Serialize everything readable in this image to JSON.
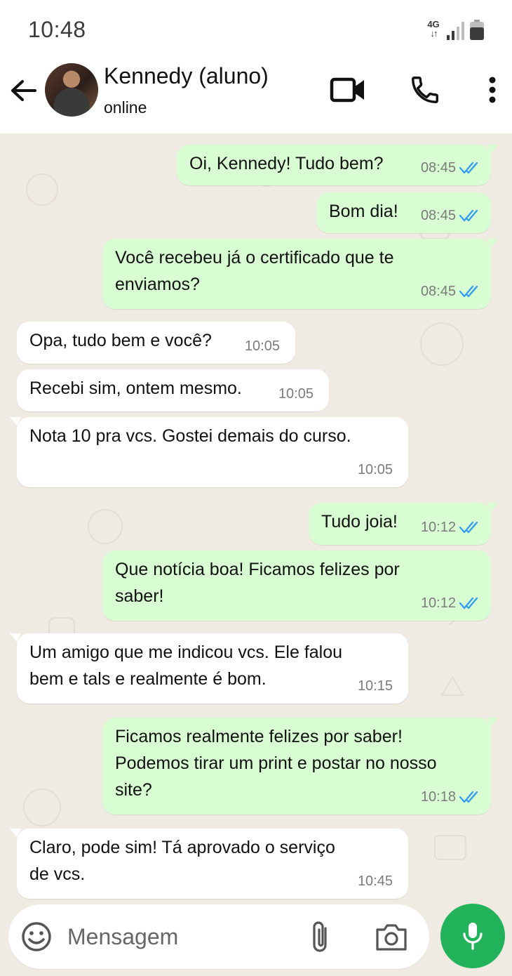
{
  "status_bar": {
    "time": "10:48",
    "network": "4G",
    "icons": [
      "signal-icon",
      "battery-icon"
    ]
  },
  "header": {
    "contact_name": "Kennedy (aluno)",
    "contact_status": "online",
    "icons": [
      "back-arrow-icon",
      "video-call-icon",
      "phone-icon",
      "more-options-icon"
    ]
  },
  "messages": [
    {
      "direction": "out",
      "text": "Oi, Kennedy! Tudo bem?",
      "time": "08:45",
      "read": true
    },
    {
      "direction": "out",
      "text": "Bom dia!",
      "time": "08:45",
      "read": true
    },
    {
      "direction": "out",
      "text": "Você recebeu já o certificado que te\nenviamos?",
      "time": "08:45",
      "read": true
    },
    {
      "direction": "in",
      "text": "Opa, tudo bem e você?",
      "time": "10:05"
    },
    {
      "direction": "in",
      "text": "Recebi sim, ontem mesmo.",
      "time": "10:05"
    },
    {
      "direction": "in",
      "text": "Nota 10 pra vcs. Gostei demais do curso.",
      "time": "10:05"
    },
    {
      "direction": "out",
      "text": "Tudo joia!",
      "time": "10:12",
      "read": true
    },
    {
      "direction": "out",
      "text": "Que notícia boa! Ficamos felizes por\nsaber!",
      "time": "10:12",
      "read": true
    },
    {
      "direction": "in",
      "text": "Um amigo que me indicou vcs. Ele falou\nbem e tals e realmente é bom.",
      "time": "10:15"
    },
    {
      "direction": "out",
      "text": "Ficamos realmente felizes por saber!\nPodemos tirar um print e postar no nosso\nsite?",
      "time": "10:18",
      "read": true
    },
    {
      "direction": "in",
      "text": "Claro, pode sim! Tá aprovado o serviço\nde vcs.",
      "time": "10:45"
    }
  ],
  "composer": {
    "placeholder": "Mensagem",
    "icons": [
      "emoji-icon",
      "attach-icon",
      "camera-icon",
      "mic-icon"
    ]
  },
  "colors": {
    "outgoing_bubble": "#d9fdd3",
    "incoming_bubble": "#ffffff",
    "chat_background": "#efeae2",
    "read_tick": "#2f9bf0",
    "mic_button": "#21b25a"
  }
}
